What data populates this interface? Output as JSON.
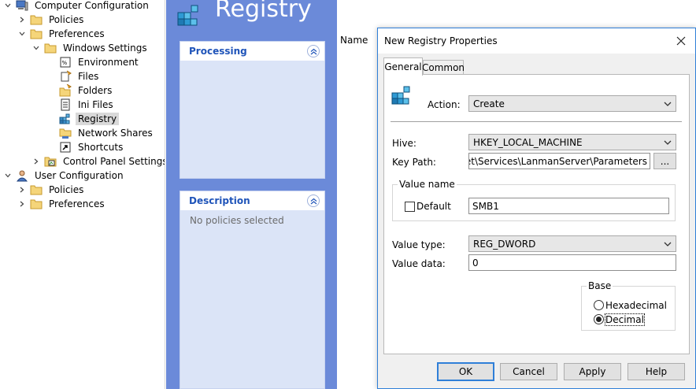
{
  "tree": {
    "items": [
      {
        "label": "Computer Configuration",
        "icon": "computer-icon"
      },
      {
        "label": "Policies",
        "icon": "folder-icon"
      },
      {
        "label": "Preferences",
        "icon": "folder-icon"
      },
      {
        "label": "Windows Settings",
        "icon": "folder-icon"
      },
      {
        "label": "Environment",
        "icon": "environment-icon"
      },
      {
        "label": "Files",
        "icon": "files-icon"
      },
      {
        "label": "Folders",
        "icon": "folders-icon"
      },
      {
        "label": "Ini Files",
        "icon": "ini-files-icon"
      },
      {
        "label": "Registry",
        "icon": "registry-icon"
      },
      {
        "label": "Network Shares",
        "icon": "network-shares-icon"
      },
      {
        "label": "Shortcuts",
        "icon": "shortcut-icon"
      },
      {
        "label": "Control Panel Settings",
        "icon": "control-panel-icon"
      },
      {
        "label": "User Configuration",
        "icon": "user-icon"
      },
      {
        "label": "Policies",
        "icon": "folder-icon"
      },
      {
        "label": "Preferences",
        "icon": "folder-icon"
      }
    ]
  },
  "pane": {
    "title": "Registry",
    "processing_header": "Processing",
    "description_header": "Description",
    "description_text": "No policies selected",
    "column_name": "Name"
  },
  "dialog": {
    "title": "New Registry Properties",
    "tabs": [
      "General",
      "Common"
    ],
    "action_label": "Action:",
    "action_value": "Create",
    "hive_label": "Hive:",
    "hive_value": "HKEY_LOCAL_MACHINE",
    "keypath_label": "Key Path:",
    "keypath_value": "ontrolSet\\Services\\LanmanServer\\Parameters",
    "browse_label": "...",
    "value_name_group": "Value name",
    "default_label": "Default",
    "value_name_value": "SMB1",
    "value_type_label": "Value type:",
    "value_type_value": "REG_DWORD",
    "value_data_label": "Value data:",
    "value_data_value": "0",
    "base_group": "Base",
    "hexadecimal_label": "Hexadecimal",
    "decimal_label": "Decimal",
    "buttons": {
      "ok": "OK",
      "cancel": "Cancel",
      "apply": "Apply",
      "help": "Help"
    }
  },
  "colors": {
    "pane_blue": "#6b8ad9",
    "header_text_blue": "#1f54b9",
    "dialog_border": "#2f7fd8"
  }
}
